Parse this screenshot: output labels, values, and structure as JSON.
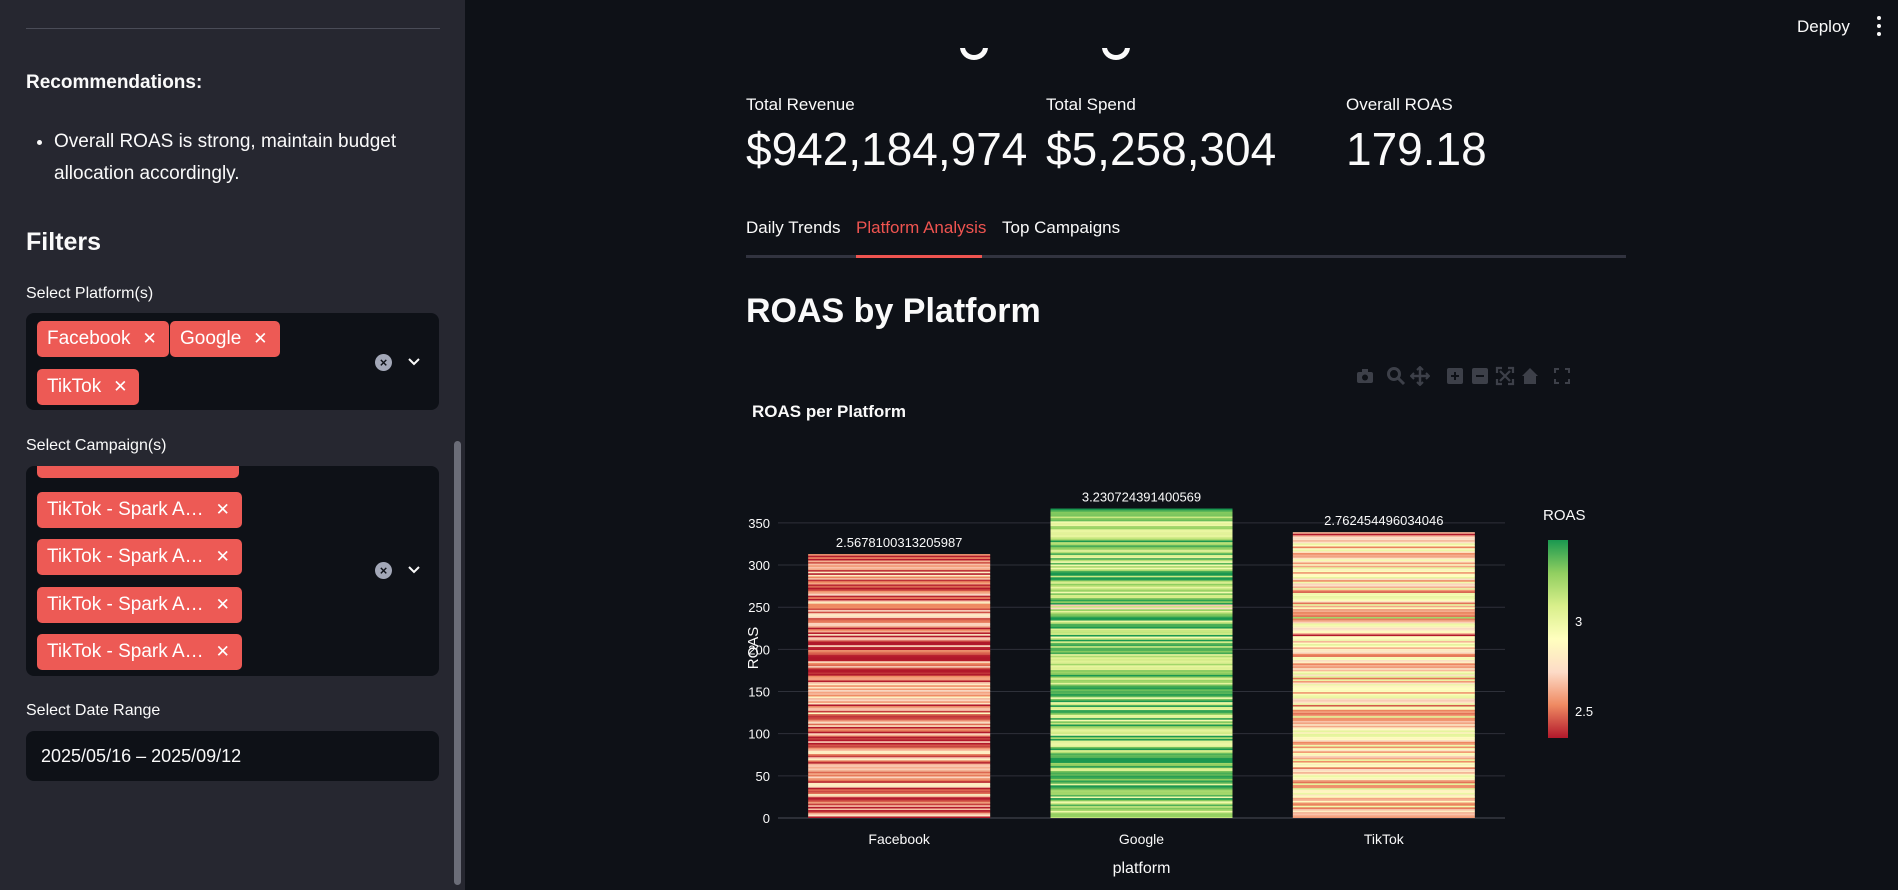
{
  "sidebar": {
    "recommendations_heading": "Recommendations:",
    "recommendations": [
      "Overall ROAS is strong, maintain budget allocation accordingly."
    ],
    "filters_heading": "Filters",
    "platform_label": "Select Platform(s)",
    "platform_tags": [
      "Facebook",
      "Google",
      "TikTok"
    ],
    "campaign_label": "Select Campaign(s)",
    "campaign_tags": [
      "TikTok - Spark A…",
      "TikTok - Spark A…",
      "TikTok - Spark A…",
      "TikTok - Spark A…"
    ],
    "date_label": "Select Date Range",
    "date_value": "2025/05/16 – 2025/09/12"
  },
  "header": {
    "deploy_label": "Deploy"
  },
  "metrics": [
    {
      "label": "Total Revenue",
      "value": "$942,184,974"
    },
    {
      "label": "Total Spend",
      "value": "$5,258,304"
    },
    {
      "label": "Overall ROAS",
      "value": "179.18"
    }
  ],
  "tabs": [
    {
      "label": "Daily Trends",
      "active": false
    },
    {
      "label": "Platform Analysis",
      "active": true
    },
    {
      "label": "Top Campaigns",
      "active": false
    }
  ],
  "section_title": "ROAS by Platform",
  "modebar_icons": [
    "camera-icon",
    "zoom-icon",
    "pan-icon",
    "zoom-in-icon",
    "zoom-out-icon",
    "autoscale-icon",
    "home-icon",
    "fullscreen-icon"
  ],
  "colors": {
    "accent": "#ef5450",
    "tag": "#ed5a55",
    "background": "#0e1117",
    "sidebar": "#262730"
  },
  "chart_data": {
    "type": "bar",
    "title": "ROAS per Platform",
    "xlabel": "platform",
    "ylabel": "ROAS",
    "categories": [
      "Facebook",
      "Google",
      "TikTok"
    ],
    "values": [
      313,
      367,
      339
    ],
    "bar_labels": [
      "2.5678100313205987",
      "3.230724391400569",
      "2.762454496034046"
    ],
    "mean_roas": [
      2.5678100313205987,
      3.230724391400569,
      2.762454496034046
    ],
    "ylim": [
      0,
      370
    ],
    "yticks": [
      0,
      50,
      100,
      150,
      200,
      250,
      300,
      350
    ],
    "grid": true,
    "colorbar": {
      "title": "ROAS",
      "ticks": [
        2.5,
        3
      ],
      "range": [
        2.35,
        3.45
      ],
      "colorscale": [
        "#b2182b",
        "#ef8a62",
        "#fddbc7",
        "#ffffbf",
        "#d9ef8b",
        "#91cf60",
        "#1a9850"
      ]
    }
  }
}
